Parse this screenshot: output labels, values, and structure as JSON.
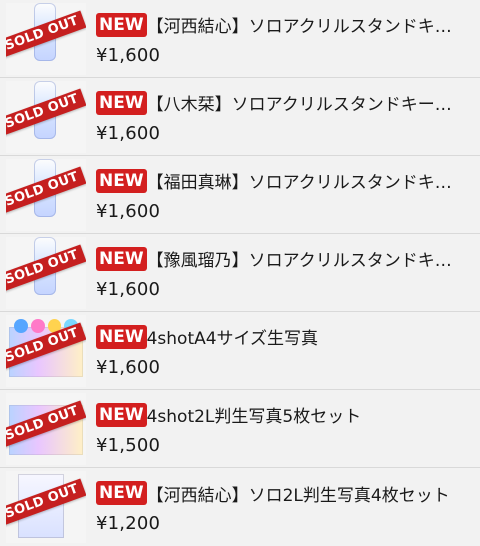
{
  "items": [
    {
      "badge": "NEW",
      "title": "【河西結心】ソロアクリルスタンドキ…",
      "price": "¥1,600",
      "sold_out": "SOLD OUT",
      "thumb": "keychain-thumb"
    },
    {
      "badge": "NEW",
      "title": "【八木栞】ソロアクリルスタンドキー…",
      "price": "¥1,600",
      "sold_out": "SOLD OUT",
      "thumb": "keychain-thumb"
    },
    {
      "badge": "NEW",
      "title": "【福田真琳】ソロアクリルスタンドキ…",
      "price": "¥1,600",
      "sold_out": "SOLD OUT",
      "thumb": "keychain-thumb"
    },
    {
      "badge": "NEW",
      "title": "【豫風瑠乃】ソロアクリルスタンドキ…",
      "price": "¥1,600",
      "sold_out": "SOLD OUT",
      "thumb": "keychain-thumb"
    },
    {
      "badge": "NEW",
      "title": "4shotA4サイズ生写真",
      "price": "¥1,600",
      "sold_out": "SOLD OUT",
      "thumb": "photo-thumb"
    },
    {
      "badge": "NEW",
      "title": "4shot2L判生写真5枚セット",
      "price": "¥1,500",
      "sold_out": "SOLD OUT",
      "thumb": "photo-thumb"
    },
    {
      "badge": "NEW",
      "title": "【河西結心】ソロ2L判生写真4枚セット",
      "price": "¥1,200",
      "sold_out": "SOLD OUT",
      "thumb": "poster-thumb"
    }
  ],
  "colors": {
    "badge_red": "#d31f1f",
    "soldout_red": "#c51f1f",
    "background": "#f2f2f2",
    "text": "#1a1a1a"
  }
}
